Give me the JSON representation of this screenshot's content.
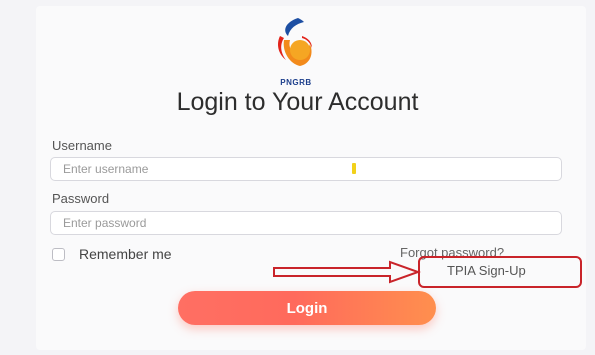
{
  "brand": {
    "logo_text": "PNGRB"
  },
  "form": {
    "title": "Login to Your Account",
    "username_label": "Username",
    "username_placeholder": "Enter username",
    "password_label": "Password",
    "password_placeholder": "Enter password",
    "remember_label": "Remember me",
    "forgot_link": "Forgot password?",
    "signup_link": "TPIA Sign-Up",
    "login_button": "Login"
  },
  "colors": {
    "annotation": "#c9242a",
    "login_gradient_start": "#ff6f63",
    "login_gradient_end": "#ff8f4e",
    "logo_blue": "#1d3f8c",
    "logo_orange": "#f28a1b"
  },
  "icons": {
    "logo": "pngrb-flame-logo",
    "annotation_arrow": "right-arrow-icon"
  }
}
